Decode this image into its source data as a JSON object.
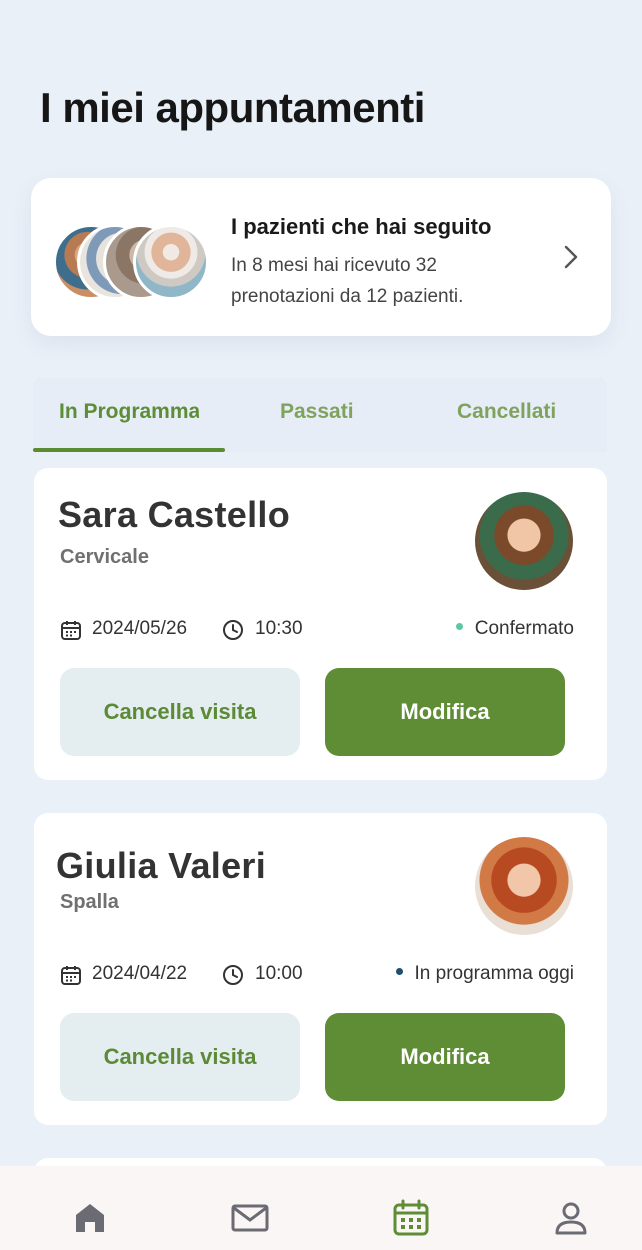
{
  "page": {
    "title": "I miei appuntamenti"
  },
  "summary": {
    "title": "I pazienti che hai seguito",
    "description": "In 8 mesi hai ricevuto 32 prenotazioni da 12 pazienti."
  },
  "tabs": [
    {
      "label": "In Programma",
      "active": true
    },
    {
      "label": "Passati",
      "active": false
    },
    {
      "label": "Cancellati",
      "active": false
    }
  ],
  "appointments": [
    {
      "name": "Sara Castello",
      "body_part": "Cervicale",
      "date": "2024/05/26",
      "time": "10:30",
      "status": "Confermato",
      "status_color": "#5cc8a0",
      "cancel_label": "Cancella visita",
      "edit_label": "Modifica"
    },
    {
      "name": "Giulia Valeri",
      "body_part": "Spalla",
      "date": "2024/04/22",
      "time": "10:00",
      "status": "In programma oggi",
      "status_color": "#1f4e6e",
      "cancel_label": "Cancella visita",
      "edit_label": "Modifica"
    }
  ],
  "nav": {
    "items": [
      {
        "icon": "home-icon",
        "active": false
      },
      {
        "icon": "mail-icon",
        "active": false
      },
      {
        "icon": "calendar-icon",
        "active": true
      },
      {
        "icon": "profile-icon",
        "active": false
      }
    ]
  },
  "colors": {
    "accent": "#5e8d35",
    "background": "#eaf0f8"
  }
}
